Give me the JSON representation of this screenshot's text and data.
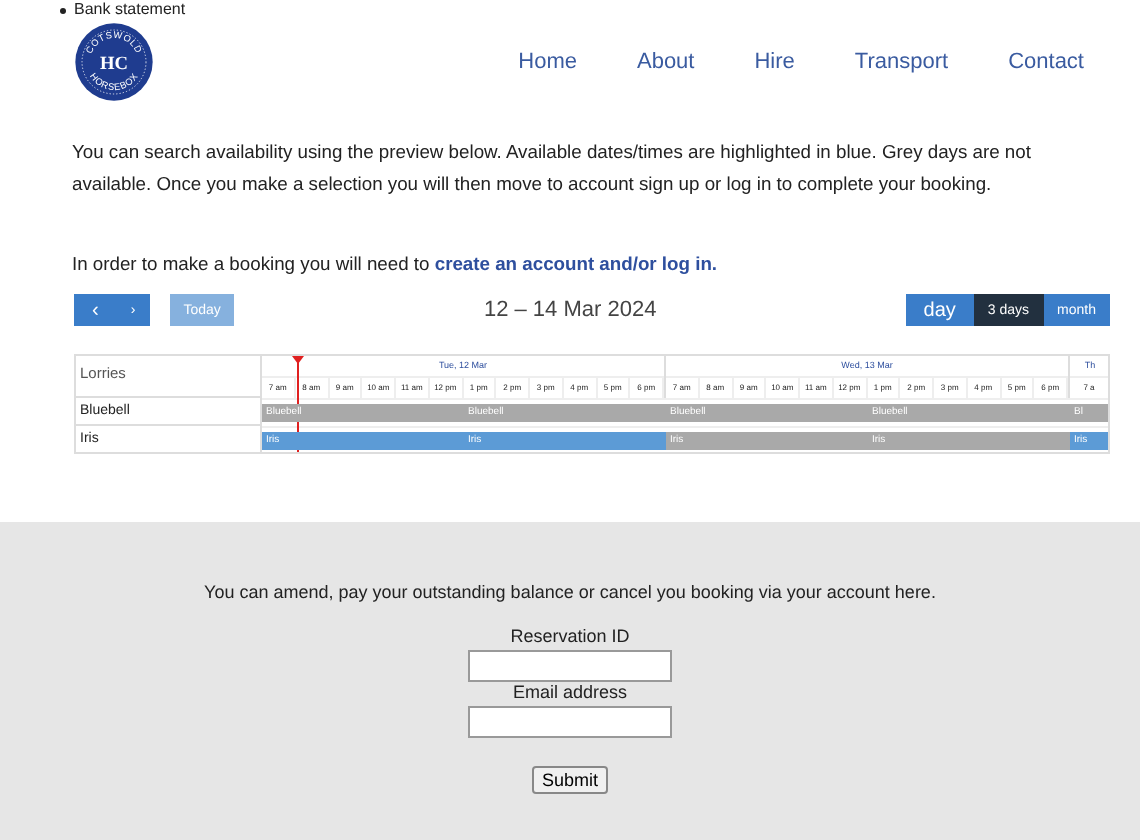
{
  "top_link": "Bank statement",
  "logo": {
    "top": "COTSWOLD",
    "bottom": "HORSEBOX",
    "monogram": "HC"
  },
  "nav": [
    "Home",
    "About",
    "Hire",
    "Transport",
    "Contact"
  ],
  "intro": "You can search availability using the preview below. Available dates/times are highlighted in blue. Grey days are not available. Once you make a selection you will then move to account sign up or log in to complete your booking.",
  "login_note": {
    "text": "In order to make a booking you will need to",
    "link": "create an account and/or log in."
  },
  "calendar": {
    "prev": "‹",
    "next": "›",
    "today": "Today",
    "title": "12 – 14 Mar 2024",
    "views": [
      {
        "label": "day",
        "selected": false
      },
      {
        "label": "3 days",
        "selected": true
      },
      {
        "label": "month",
        "selected": false
      }
    ],
    "resource_heading": "Lorries",
    "days": [
      {
        "label": "Tue, 12 Mar",
        "hours": [
          "7 am",
          "8 am",
          "9 am",
          "10 am",
          "11 am",
          "12 pm",
          "1 pm",
          "2 pm",
          "3 pm",
          "4 pm",
          "5 pm",
          "6 pm"
        ]
      },
      {
        "label": "Wed, 13 Mar",
        "hours": [
          "7 am",
          "8 am",
          "9 am",
          "10 am",
          "11 am",
          "12 pm",
          "1 pm",
          "2 pm",
          "3 pm",
          "4 pm",
          "5 pm",
          "6 pm"
        ]
      },
      {
        "label": "Th",
        "hours": [
          "7 a"
        ]
      }
    ],
    "rows": [
      {
        "name": "Bluebell",
        "events": [
          {
            "label": "Bluebell",
            "available": false
          },
          {
            "label": "Bluebell",
            "available": false
          },
          {
            "label": "Bluebell",
            "available": false
          },
          {
            "label": "Bluebell",
            "available": false
          },
          {
            "label": "Bl",
            "available": false
          }
        ]
      },
      {
        "name": "Iris",
        "events": [
          {
            "label": "Iris",
            "available": true
          },
          {
            "label": "Iris",
            "available": true
          },
          {
            "label": "Iris",
            "available": false
          },
          {
            "label": "Iris",
            "available": false
          },
          {
            "label": "Iris",
            "available": true
          }
        ]
      }
    ]
  },
  "account": {
    "text": "You can amend, pay your outstanding balance or cancel you booking via your account here.",
    "fields": [
      {
        "label": "Reservation ID"
      },
      {
        "label": "Email address"
      }
    ],
    "submit": "Submit"
  }
}
